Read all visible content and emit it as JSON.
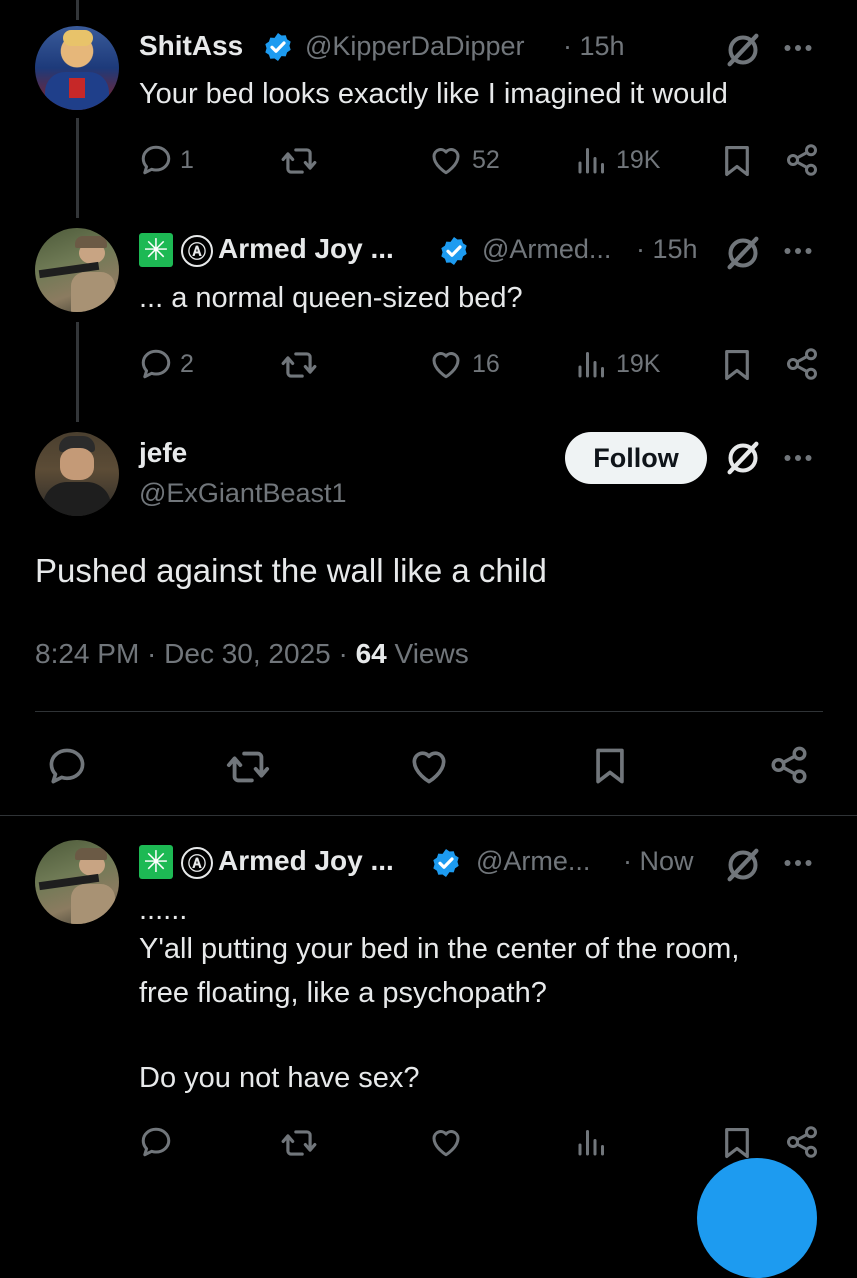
{
  "tweets": [
    {
      "name": "ShitAss",
      "handle": "@KipperDaDipper",
      "time": "· 15h",
      "text": "Your bed looks exactly like I imagined it would",
      "replies": "1",
      "likes": "52",
      "views": "19K"
    },
    {
      "flag_glyph": "✳",
      "anarchy_glyph": "Ⓐ",
      "name": "Armed Joy ...",
      "handle": "@Armed...",
      "time": "· 15h",
      "text": "... a normal queen-sized bed?",
      "replies": "2",
      "likes": "16",
      "views": "19K"
    }
  ],
  "main": {
    "name": "jefe",
    "handle": "@ExGiantBeast1",
    "follow_label": "Follow",
    "text": "Pushed against the wall like a child",
    "time": "8:24 PM · Dec 30, 2025 · ",
    "views_count": "64",
    "views_label": " Views"
  },
  "reply": {
    "flag_glyph": "✳",
    "anarchy_glyph": "Ⓐ",
    "name": "Armed Joy ...",
    "handle": "@Arme...",
    "time": "· Now",
    "line1": "......",
    "line2": "Y'all putting your bed in the center of the room,",
    "line3": "free floating, like a psychopath?",
    "line4": "Do you not have sex?"
  },
  "icons": {
    "more": "more-icon",
    "grok": "grok-icon",
    "reply": "reply-icon",
    "retweet": "retweet-icon",
    "like": "like-icon",
    "views": "views-icon",
    "bookmark": "bookmark-icon",
    "share": "share-icon",
    "verified": "verified-badge-icon"
  },
  "colors": {
    "background": "#000000",
    "text": "#e7e9ea",
    "muted": "#71767b",
    "verified": "#1d9bf0",
    "flag": "#1db954"
  }
}
